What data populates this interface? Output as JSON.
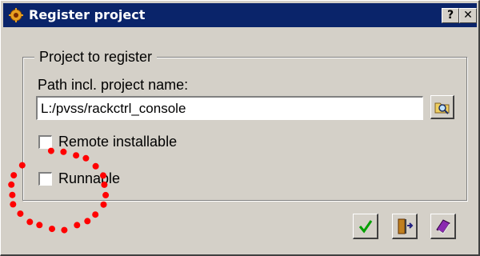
{
  "window": {
    "title": "Register project",
    "help_button": "?",
    "close_button": "✕"
  },
  "group": {
    "legend": "Project to register",
    "path_label": "Path incl. project name:",
    "path_value": "L:/pvss/rackctrl_console"
  },
  "options": {
    "remote_installable": {
      "label": "Remote installable",
      "checked": false
    },
    "runnable": {
      "label": "Runnable",
      "checked": false
    }
  },
  "buttons": {
    "browse_icon": "folder-search-icon",
    "ok_icon": "checkmark-icon",
    "exit_icon": "exit-door-icon",
    "help_icon": "help-book-icon"
  },
  "colors": {
    "titlebar": "#0a246a",
    "dialog_face": "#d4d0c8",
    "annotation": "#ff0000",
    "ok_check": "#00a000"
  }
}
